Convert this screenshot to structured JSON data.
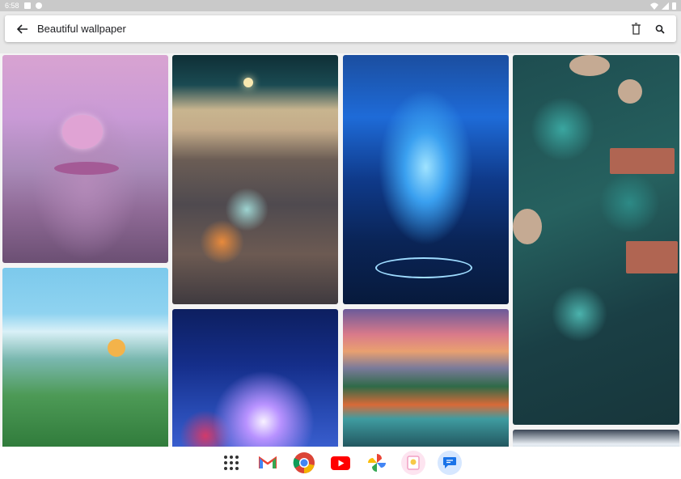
{
  "status_bar": {
    "time": "6:58"
  },
  "toolbar": {
    "title": "Beautiful wallpaper"
  },
  "grid": {
    "tiles": [
      "purple-tree-sea",
      "glass-pebble-beach",
      "blue-water-splash",
      "teal-stone-wall",
      "mountain-cranes-sun",
      "crystal-heart-rose",
      "sunset-mountain-lake",
      "sky-clouds"
    ]
  },
  "dock": {
    "items": [
      "apps-icon",
      "gmail-icon",
      "chrome-icon",
      "youtube-icon",
      "photos-icon",
      "gallery-icon",
      "messages-icon"
    ]
  },
  "colors": {
    "toolbar_bg": "#ffffff",
    "status_bar_bg": "#c9c9c9",
    "dock_bg": "#ffffff"
  }
}
